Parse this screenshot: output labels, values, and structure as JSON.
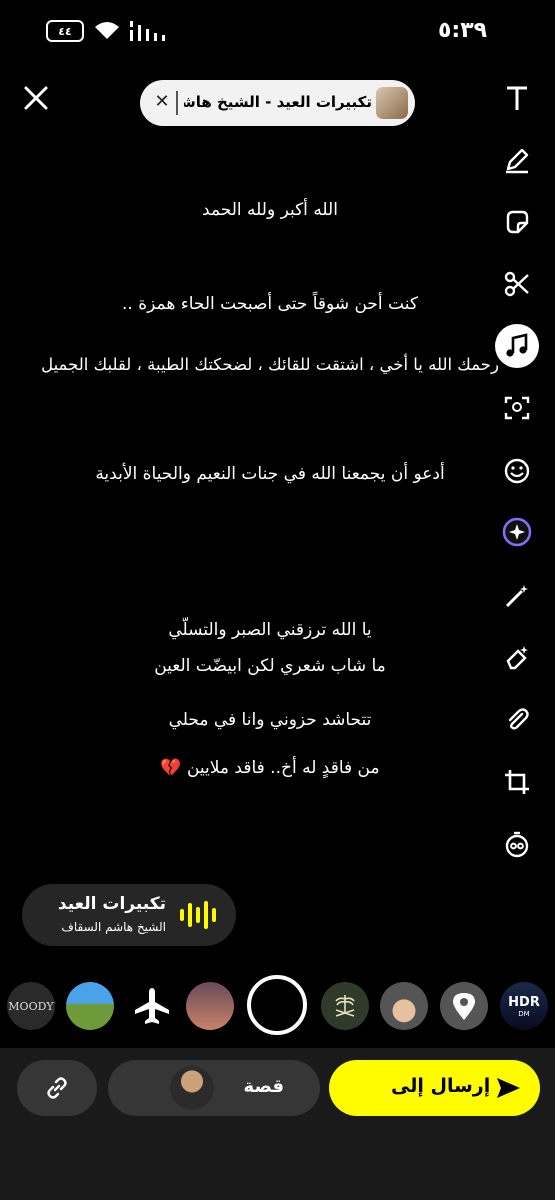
{
  "status": {
    "time": "٥:٣٩",
    "battery": "٤٤"
  },
  "music": {
    "title": "تكبيرات العيد - الشيخ هاشـ..."
  },
  "caption_lines": [
    "الله أكبر ولله الحمد",
    "كنت أحن شوقاً حتى أصبحت الحاء همزة ..",
    "رحمك الله يا أخي ، اشتقت للقائك ، لضحكتك الطيبة ، لقلبك الجميل",
    "أدعو أن يجمعنا الله في جنات النعيم والحياة الأبدية",
    "يا الله ترزقني الصبر والتسلّي",
    "ما شاب شعري لكن ابيضّت العين",
    "تتحاشد حزوني وانا في محلي",
    "من فاقدٍ له أخ.. فاقد ملايين 💔"
  ],
  "song_card": {
    "name": "تكبيرات العيد",
    "artist": "الشيخ هاشم السقاف"
  },
  "filters": {
    "moody": "MOODY",
    "hdr": "HDR",
    "hdr_sub": "DM"
  },
  "bottom": {
    "story_label": "قصة",
    "send_label": "إرسال إلى"
  },
  "colors": {
    "accent": "#fffc00",
    "pill_bg": "#f2f2f2"
  }
}
